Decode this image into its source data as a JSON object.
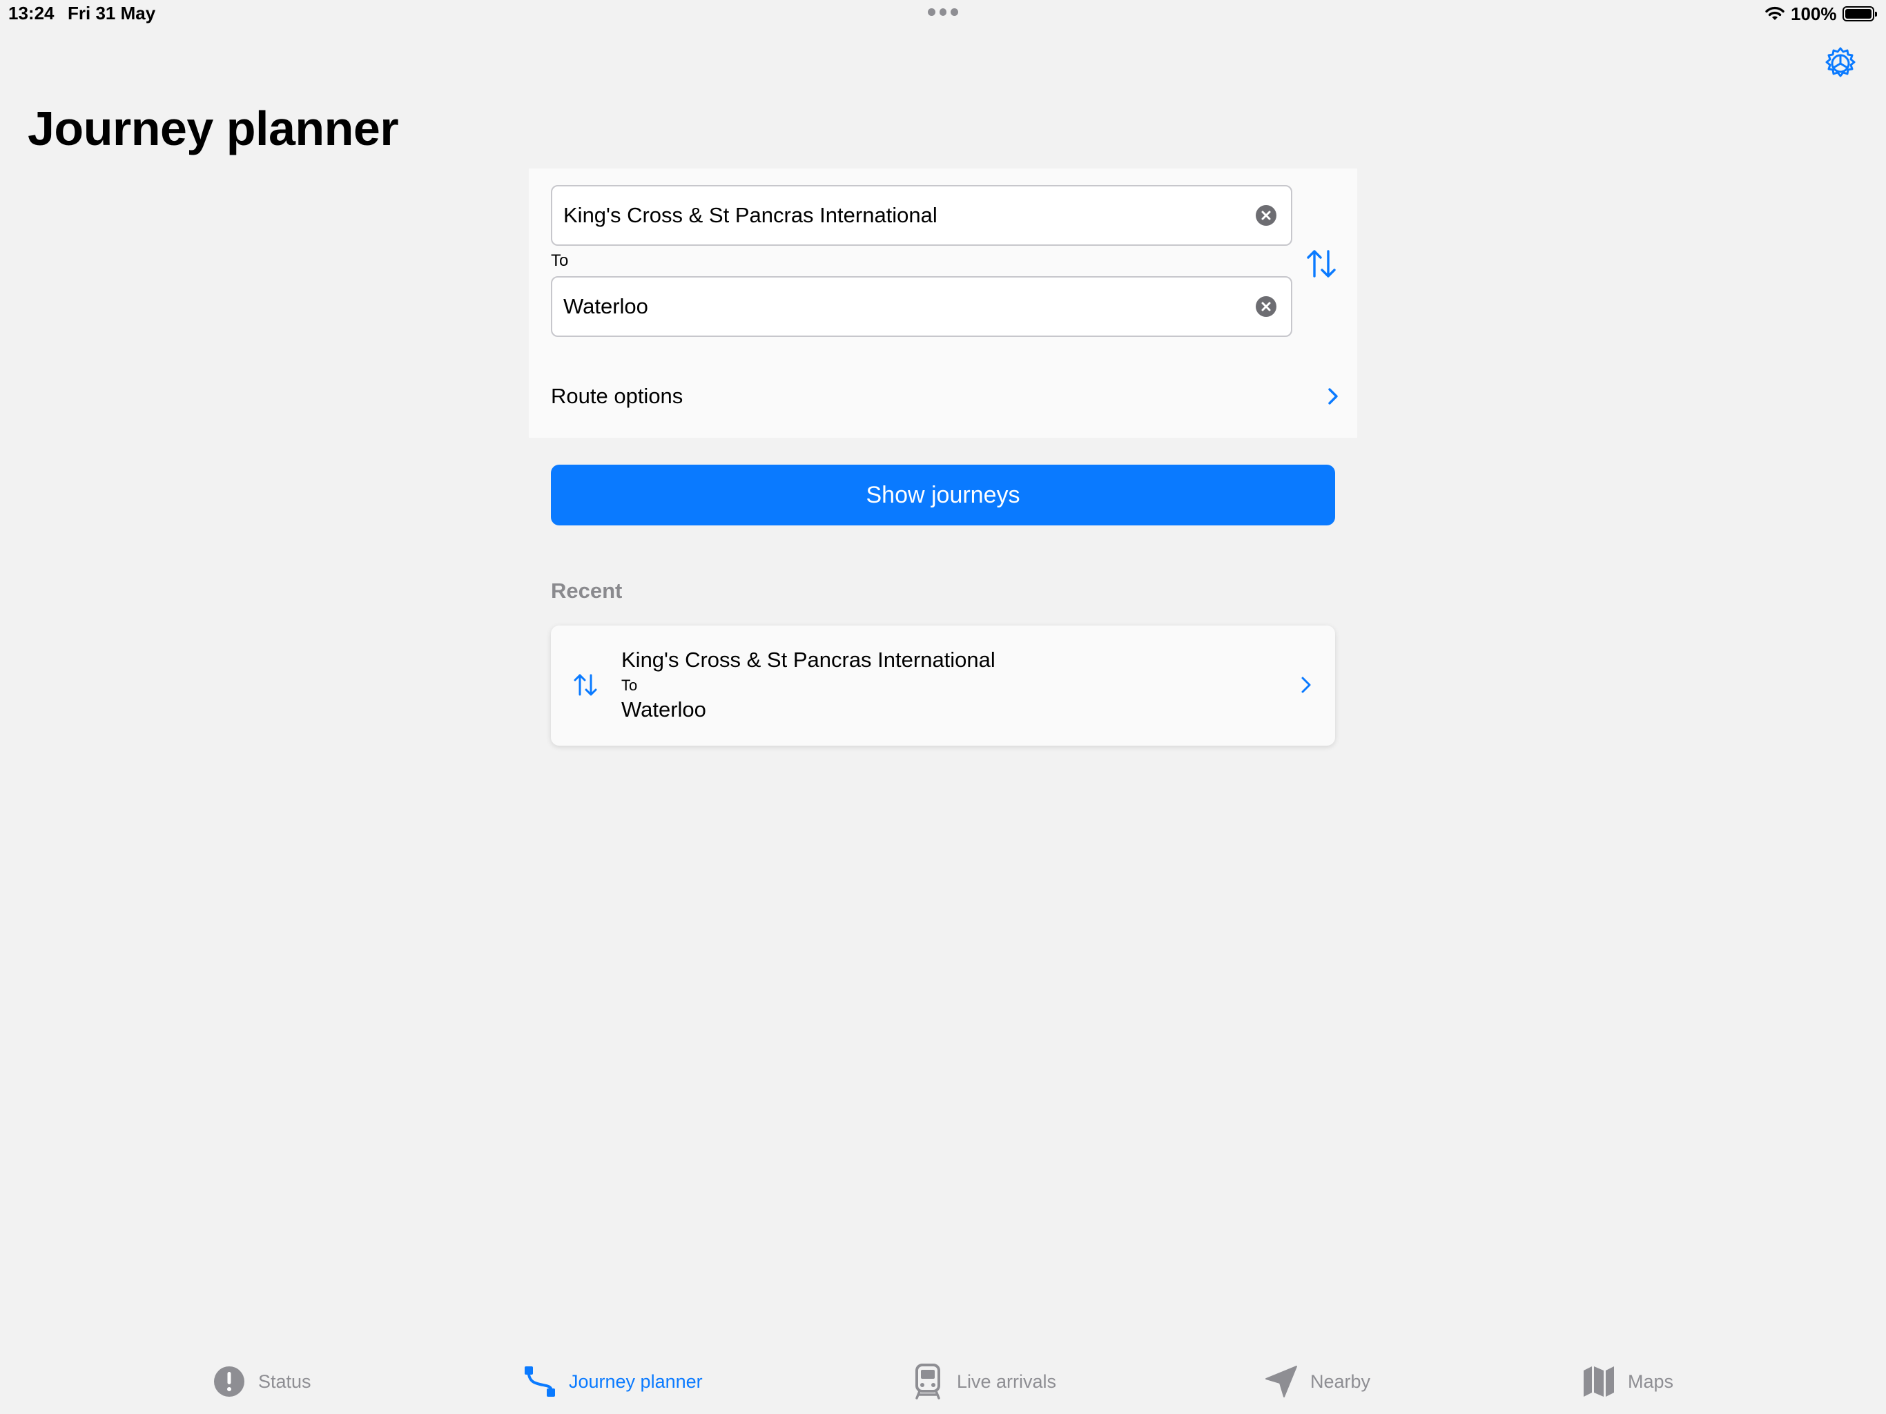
{
  "status_bar": {
    "time": "13:24",
    "date": "Fri 31 May",
    "battery": "100%"
  },
  "page": {
    "title": "Journey planner"
  },
  "form": {
    "from_value": "King's Cross & St Pancras International",
    "to_label": "To",
    "to_value": "Waterloo",
    "route_options_label": "Route options"
  },
  "actions": {
    "show_journeys_label": "Show journeys"
  },
  "recent": {
    "heading": "Recent",
    "items": [
      {
        "from": "King's Cross & St Pancras International",
        "to_label": "To",
        "to": "Waterloo"
      }
    ]
  },
  "tab_bar": {
    "tabs": [
      {
        "label": "Status",
        "icon": "exclamation-circle-icon",
        "active": false
      },
      {
        "label": "Journey planner",
        "icon": "route-icon",
        "active": true
      },
      {
        "label": "Live arrivals",
        "icon": "train-icon",
        "active": false
      },
      {
        "label": "Nearby",
        "icon": "location-arrow-icon",
        "active": false
      },
      {
        "label": "Maps",
        "icon": "map-icon",
        "active": false
      }
    ]
  },
  "colors": {
    "accent": "#0a7aff",
    "background": "#f2f2f2",
    "inactive": "#8e8e93"
  }
}
